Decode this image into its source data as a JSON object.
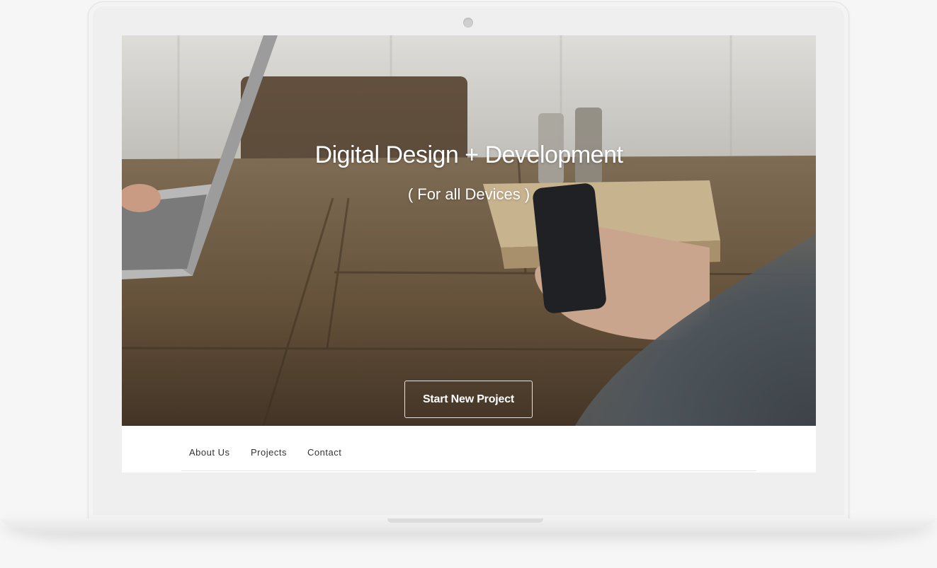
{
  "hero": {
    "title": "Digital Design + Development",
    "subtitle": "( For all Devices )",
    "cta_label": "Start New Project"
  },
  "nav": {
    "items": [
      {
        "label": "About Us"
      },
      {
        "label": "Projects"
      },
      {
        "label": "Contact"
      }
    ]
  },
  "colors": {
    "page_background": "#f6f6f6",
    "bezel": "#efefef",
    "text_on_hero": "#ffffff",
    "nav_text": "#333333"
  }
}
